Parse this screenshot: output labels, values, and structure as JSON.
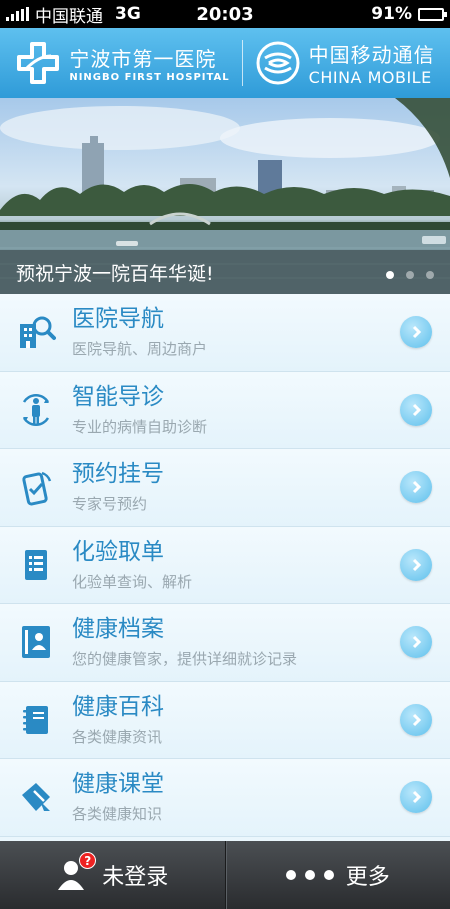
{
  "status_bar": {
    "carrier": "中国联通",
    "network": "3G",
    "time": "20:03",
    "battery_text": "91%",
    "battery_level": 0.91
  },
  "header": {
    "hospital_name": "宁波市第一医院",
    "hospital_name_en": "NINGBO FIRST HOSPITAL",
    "partner_name": "中国移动通信",
    "partner_name_en": "CHINA MOBILE"
  },
  "banner": {
    "caption": "预祝宁波一院百年华诞!",
    "slide_count": 3,
    "active_slide": 1
  },
  "menu": [
    {
      "title": "医院导航",
      "subtitle": "医院导航、周边商户",
      "icon": "hospital-search-icon"
    },
    {
      "title": "智能导诊",
      "subtitle": "专业的病情自助诊断",
      "icon": "body-guide-icon"
    },
    {
      "title": "预约挂号",
      "subtitle": "专家号预约",
      "icon": "phone-appointment-icon"
    },
    {
      "title": "化验取单",
      "subtitle": "化验单查询、解析",
      "icon": "lab-report-icon"
    },
    {
      "title": "健康档案",
      "subtitle": "您的健康管家，提供详细就诊记录",
      "icon": "health-record-icon"
    },
    {
      "title": "健康百科",
      "subtitle": "各类健康资讯",
      "icon": "notebook-icon"
    },
    {
      "title": "健康课堂",
      "subtitle": "各类健康知识",
      "icon": "classroom-pen-icon"
    }
  ],
  "tabbar": {
    "login_label": "未登录",
    "login_badge": "?",
    "more_label": "更多"
  },
  "colors": {
    "header_blue": "#3aa6df",
    "title_blue": "#2a8ac4",
    "subtitle_gray": "#9aa8b0",
    "chevron_blue": "#5fc0ec",
    "tabbar_dark": "#2a2c2f"
  }
}
